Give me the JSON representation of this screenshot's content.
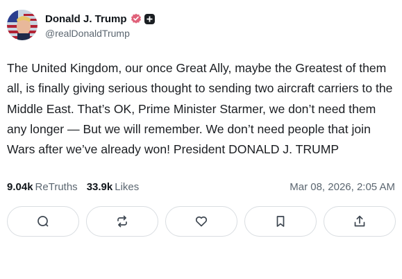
{
  "author": {
    "display_name": "Donald J. Trump",
    "handle": "@realDonaldTrump",
    "verified_color": "#e0627a"
  },
  "post": {
    "text": "The United Kingdom, our once Great Ally, maybe the Greatest of them all, is finally giving serious thought to sending two aircraft carriers to the Middle East. That’s OK, Prime Minister Starmer, we don’t need them any longer — But we will remember. We don’t need people that join Wars after we’ve already won! President DONALD J. TRUMP"
  },
  "stats": {
    "retruths_count": "9.04k",
    "retruths_label": "ReTruths",
    "likes_count": "33.9k",
    "likes_label": "Likes",
    "timestamp": "Mar 08, 2026, 2:05 AM"
  },
  "actions": [
    {
      "icon": "reply-icon"
    },
    {
      "icon": "retruth-icon"
    },
    {
      "icon": "like-icon"
    },
    {
      "icon": "bookmark-icon"
    },
    {
      "icon": "share-icon"
    }
  ]
}
